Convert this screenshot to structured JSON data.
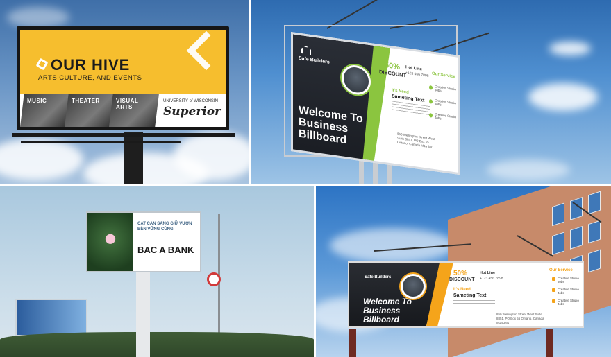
{
  "panel_ourhive": {
    "title": "OUR HIVE",
    "subtitle": "ARTS,CULTURE, AND EVENTS",
    "tiles": [
      "MUSIC",
      "THEATER",
      "VISUAL ARTS"
    ],
    "university": "UNIVERSITY of WISCONSIN",
    "brand": "Superior"
  },
  "panel_safe_builders_top": {
    "logo": "Safe Builders",
    "discount_pct": "50%",
    "discount_label": "DISCOUNT",
    "hotline_label": "Hot Line",
    "hotline_number": "+123 456 7898",
    "services_title": "Our Service",
    "need_label": "It's Need",
    "heading": "Sameting Text",
    "address": "850 Wellington Street West Suite 8851, PO Box 55 Ontario, Canada M1a 3N1",
    "services": [
      "Creative Studio Jobs",
      "Creative Studio Jobs",
      "Creative Studio Jobs"
    ],
    "welcome": "Welcome To Business Billboard",
    "accent": "#8bc53f"
  },
  "panel_bacabank": {
    "slogan": "CAT CAN SANG GIỮ VƯƠN BỀN VỮNG CÙNG",
    "bank": "BAC A BANK"
  },
  "panel_safe_builders_bottom": {
    "logo": "Safe Builders",
    "discount_pct": "50%",
    "discount_label": "DISCOUNT",
    "hotline_label": "Hot Line",
    "hotline_number": "+123 456 7898",
    "services_title": "Our Service",
    "need_label": "It's Need",
    "heading": "Sameting Text",
    "address": "850 Wellington Street West Suite 8851, PO Box 55 Ontario, Canada M1a 3N1",
    "services": [
      "Creative Studio Jobs",
      "Creative Studio Jobs",
      "Creative Studio Jobs"
    ],
    "welcome": "Welcome To Business Billboard",
    "accent": "#f5a41a"
  }
}
